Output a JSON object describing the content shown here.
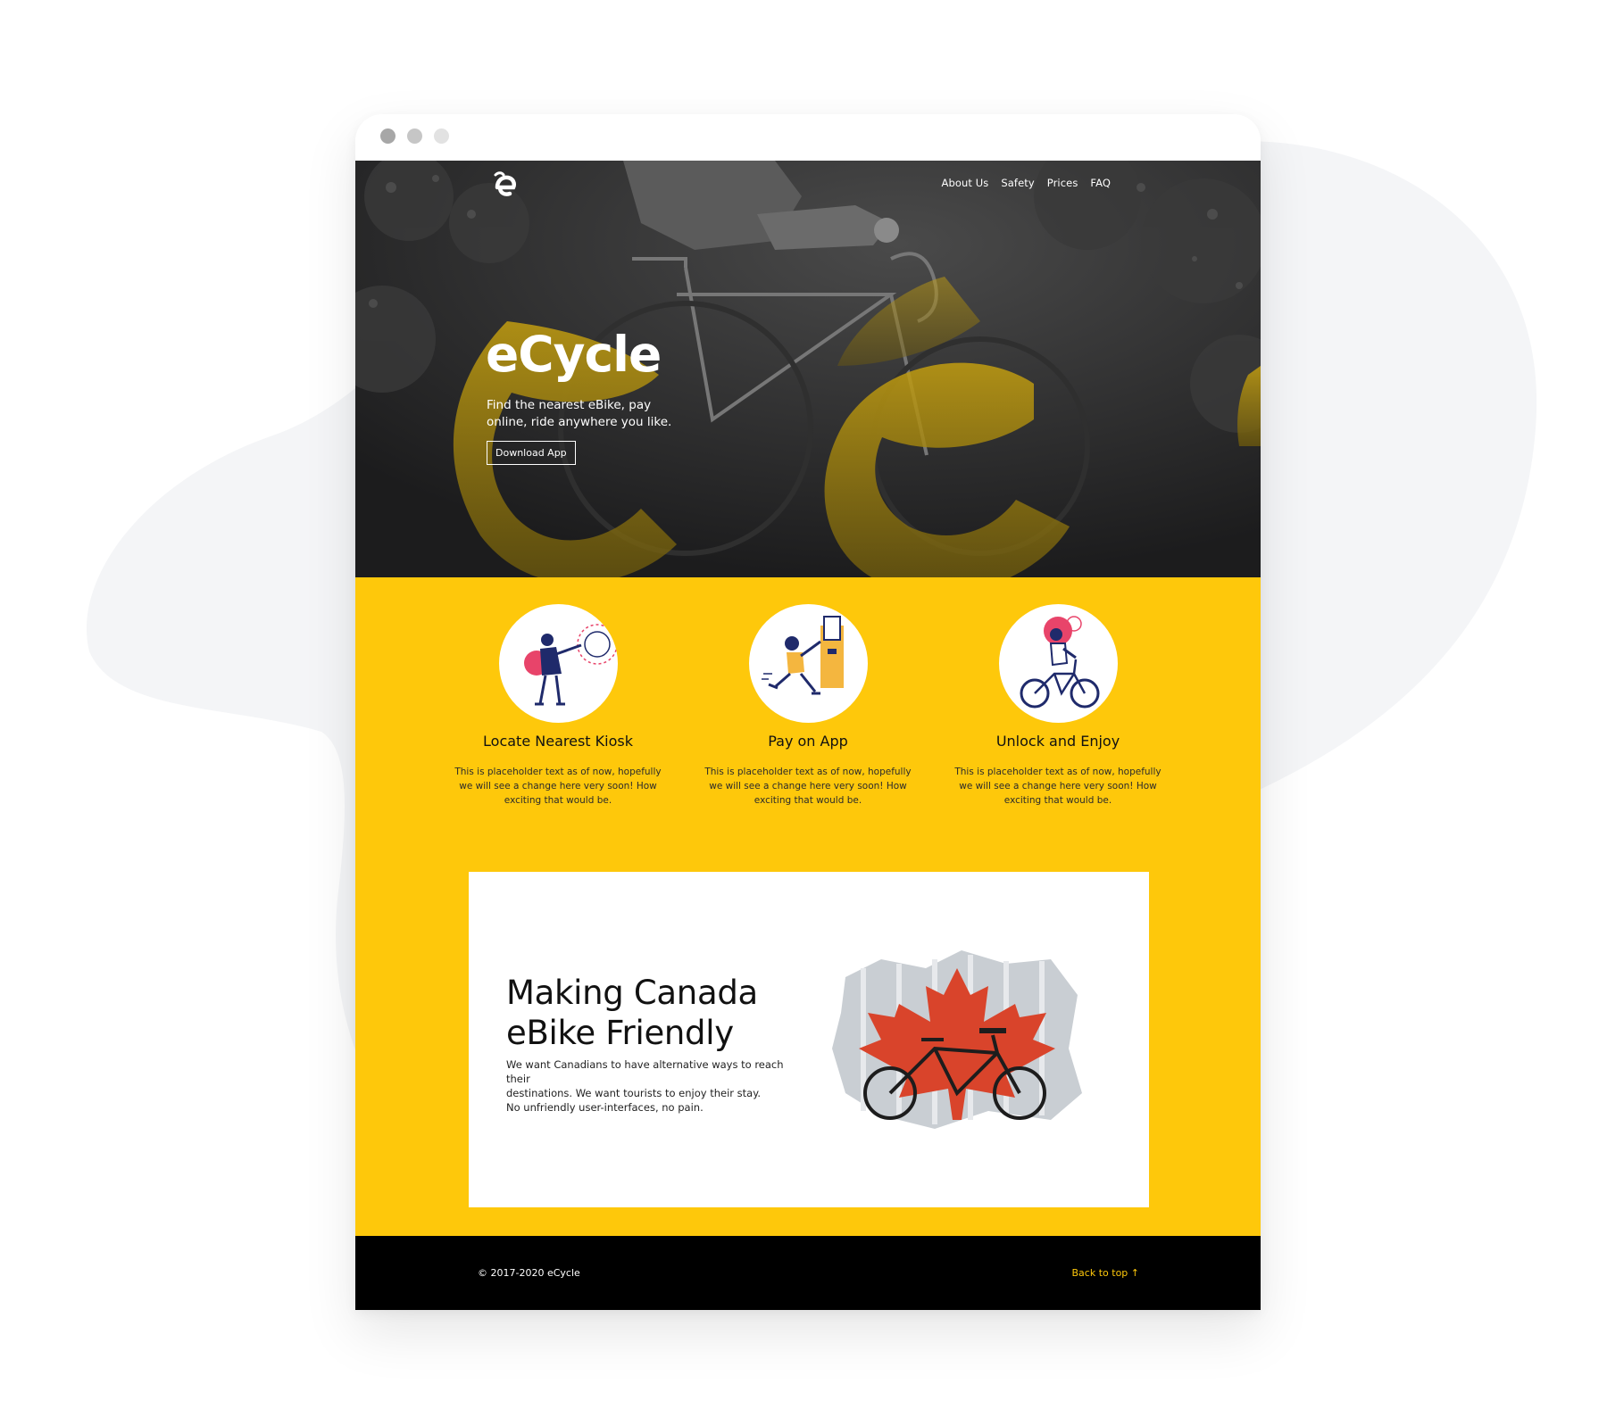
{
  "site": {
    "brand_name": "eCycle",
    "nav": [
      "About Us",
      "Safety",
      "Prices",
      "FAQ"
    ]
  },
  "hero": {
    "title": "eCycle",
    "subtitle": "Find the nearest eBike, pay online, ride anywhere you like.",
    "button_label": "Download App"
  },
  "features": [
    {
      "title": "Locate Nearest Kiosk",
      "text": "This is placeholder text as of now, hopefully we will see a change here very soon! How exciting that would be.",
      "icon": "kiosk-illustration"
    },
    {
      "title": "Pay on App",
      "text": "This is placeholder text as of now, hopefully we will see a change here very soon! How exciting that would be.",
      "icon": "payment-illustration"
    },
    {
      "title": "Unlock and Enjoy",
      "text": "This is placeholder text as of now, hopefully we will see a change here very soon! How exciting that would be.",
      "icon": "cyclist-illustration"
    }
  ],
  "about": {
    "title_line1": "Making Canada",
    "title_line2": "eBike Friendly",
    "text_line1": "We want Canadians to have alternative ways to reach their",
    "text_line2": "destinations. We want tourists to enjoy their stay.",
    "text_line3": "No unfriendly user-interfaces, no pain."
  },
  "footer": {
    "copyright": "© 2017-2020 eCycle",
    "back_to_top": "Back to top ↑"
  },
  "colors": {
    "accent": "#fec80b",
    "hero_bg": "#1e1e1f",
    "footer_bg": "#000000",
    "card_bg": "#ffffff",
    "maple_red": "#d9442b"
  }
}
